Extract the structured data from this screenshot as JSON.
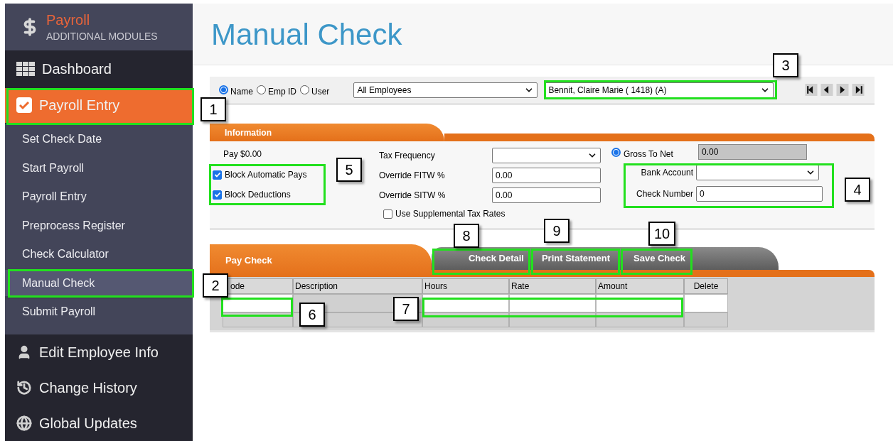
{
  "sidebar": {
    "title": "Payroll",
    "subtitle": "ADDITIONAL MODULES",
    "items": [
      {
        "kind": "main",
        "label": "Dashboard",
        "selected": false
      },
      {
        "kind": "main",
        "label": "Payroll Entry",
        "selected": true
      },
      {
        "kind": "sub",
        "label": "Set Check Date",
        "selected": false
      },
      {
        "kind": "sub",
        "label": "Start Payroll",
        "selected": false
      },
      {
        "kind": "sub",
        "label": "Payroll Entry",
        "selected": false
      },
      {
        "kind": "sub",
        "label": "Preprocess Register",
        "selected": false
      },
      {
        "kind": "sub",
        "label": "Check Calculator",
        "selected": false
      },
      {
        "kind": "sub",
        "label": "Manual Check",
        "selected": true
      },
      {
        "kind": "sub",
        "label": "Submit Payroll",
        "selected": false
      },
      {
        "kind": "main",
        "label": "Edit Employee Info",
        "selected": false
      },
      {
        "kind": "main",
        "label": "Change History",
        "selected": false
      },
      {
        "kind": "main",
        "label": "Global Updates",
        "selected": false
      }
    ]
  },
  "page_title": "Manual Check",
  "filter": {
    "radios": [
      {
        "label": "Name",
        "selected": true
      },
      {
        "label": "Emp ID",
        "selected": false
      },
      {
        "label": "User",
        "selected": false
      }
    ],
    "group_select": "All Employees",
    "employee_select": "Bennit, Claire Marie ( 1418) (A)"
  },
  "information": {
    "tab": "Information",
    "pay": "Pay $0.00",
    "checkboxes": [
      {
        "label": "Block Automatic Pays",
        "checked": true
      },
      {
        "label": "Block Deductions",
        "checked": true
      }
    ],
    "tax_fields": [
      {
        "kind": "select",
        "label": "Tax Frequency"
      },
      {
        "kind": "input",
        "label": "Override FITW %",
        "value": "0.00"
      },
      {
        "kind": "input",
        "label": "Override SITW %",
        "value": "0.00"
      }
    ],
    "supplemental": {
      "label": "Use Supplemental Tax Rates",
      "checked": false
    },
    "gross_to_net": {
      "label": "Gross To Net",
      "selected": true,
      "value": "0.00"
    },
    "bank_fields": [
      {
        "kind": "select",
        "label": "Bank Account"
      },
      {
        "kind": "input",
        "label": "Check Number",
        "value": "0"
      }
    ]
  },
  "pay_check": {
    "tab": "Pay Check",
    "buttons": [
      "Check Detail",
      "Print Statement",
      "Save Check"
    ],
    "columns": [
      "ode",
      "Description",
      "Hours",
      "Rate",
      "Amount",
      "Delete"
    ],
    "rows": [
      {
        "cells": [
          {
            "kind": "input"
          },
          {
            "kind": "blank"
          },
          {
            "kind": "input"
          },
          {
            "kind": "input"
          },
          {
            "kind": "input"
          },
          {
            "kind": "input"
          }
        ]
      },
      {
        "cells": [
          {
            "kind": "blank"
          },
          {
            "kind": "blank"
          },
          {
            "kind": "blank"
          },
          {
            "kind": "blank"
          },
          {
            "kind": "blank"
          },
          {
            "kind": "blank"
          }
        ]
      }
    ]
  },
  "callouts": [
    {
      "label": "1"
    },
    {
      "label": "2"
    },
    {
      "label": "3"
    },
    {
      "label": "4"
    },
    {
      "label": "5"
    },
    {
      "label": "6"
    },
    {
      "label": "7"
    },
    {
      "label": "8"
    },
    {
      "label": "9"
    },
    {
      "label": "10"
    }
  ]
}
